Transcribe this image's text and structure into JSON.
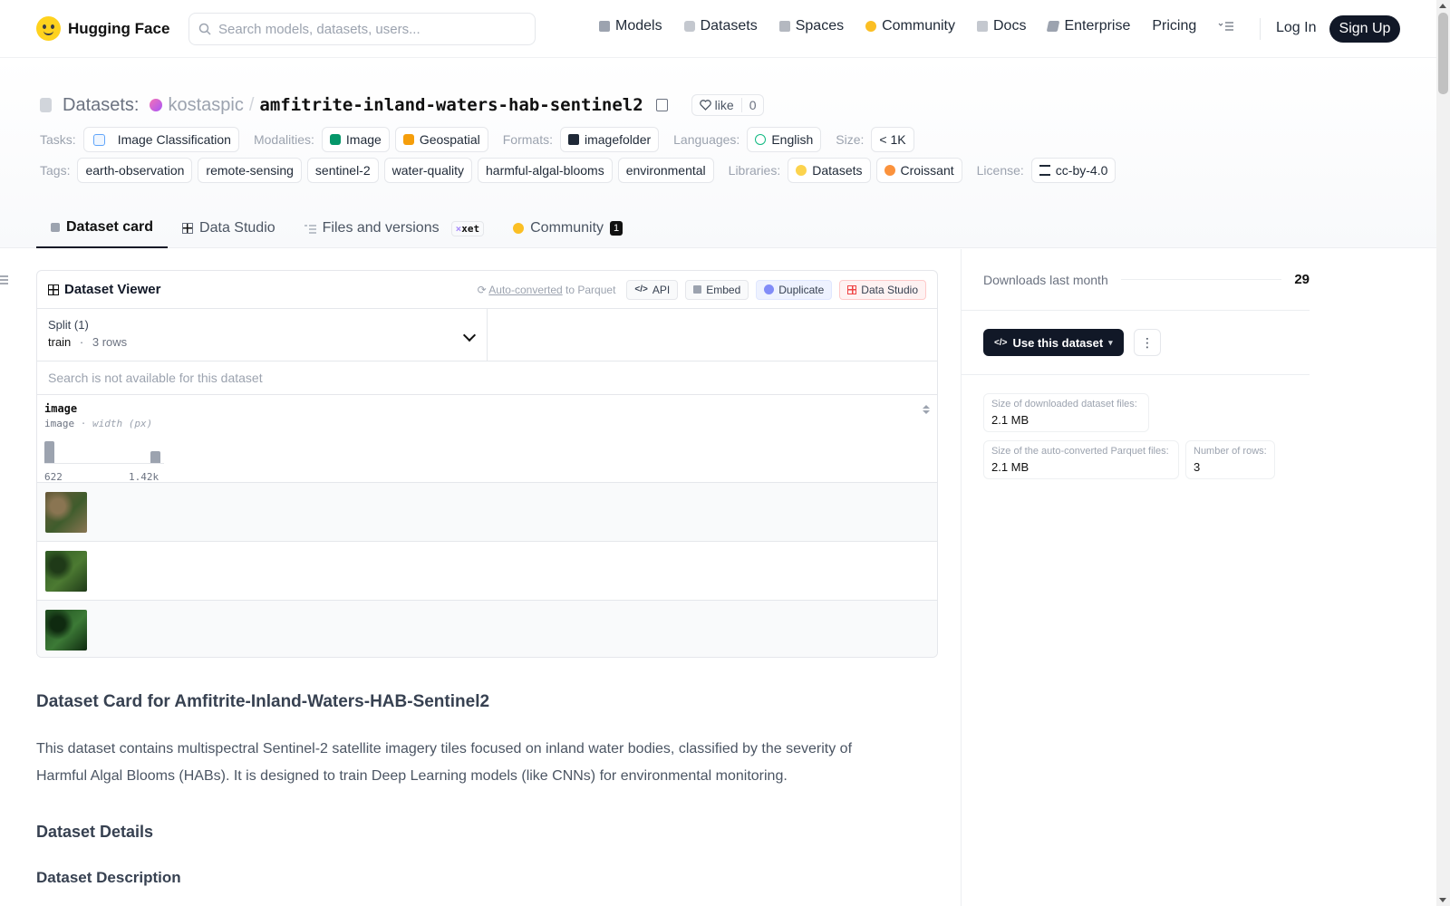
{
  "header": {
    "brand": "Hugging Face",
    "search_placeholder": "Search models, datasets, users...",
    "nav": [
      {
        "label": "Models",
        "icon": "models-icon",
        "color": "#9ca3af"
      },
      {
        "label": "Datasets",
        "icon": "datasets-icon",
        "color": "#9ca3af"
      },
      {
        "label": "Spaces",
        "icon": "spaces-icon",
        "color": "#9ca3af"
      },
      {
        "label": "Community",
        "icon": "community-icon",
        "color": "#fbbf24"
      },
      {
        "label": "Docs",
        "icon": "docs-icon",
        "color": "#9ca3af"
      },
      {
        "label": "Enterprise",
        "icon": "enterprise-icon",
        "color": "#9ca3af"
      },
      {
        "label": "Pricing"
      }
    ],
    "login": "Log In",
    "signup": "Sign Up"
  },
  "repo": {
    "type_label": "Datasets:",
    "owner": "kostaspic",
    "separator": "/",
    "name": "amfitrite-inland-waters-hab-sentinel2",
    "like_label": "like",
    "like_count": "0"
  },
  "meta": {
    "tasks_label": "Tasks:",
    "tasks": [
      "Image Classification"
    ],
    "modalities_label": "Modalities:",
    "modalities": [
      "Image",
      "Geospatial"
    ],
    "formats_label": "Formats:",
    "formats": [
      "imagefolder"
    ],
    "languages_label": "Languages:",
    "languages": [
      "English"
    ],
    "size_label": "Size:",
    "size": "< 1K",
    "tags_label": "Tags:",
    "tags": [
      "earth-observation",
      "remote-sensing",
      "sentinel-2",
      "water-quality",
      "harmful-algal-blooms",
      "environmental"
    ],
    "libraries_label": "Libraries:",
    "libraries": [
      "Datasets",
      "Croissant"
    ],
    "license_label": "License:",
    "license": "cc-by-4.0"
  },
  "tabs": [
    {
      "label": "Dataset card",
      "active": true
    },
    {
      "label": "Data Studio"
    },
    {
      "label": "Files and versions",
      "badge": "xet"
    },
    {
      "label": "Community",
      "count": "1"
    }
  ],
  "viewer": {
    "title": "Dataset Viewer",
    "auto_converted": "Auto-converted",
    "to_parquet": "to Parquet",
    "actions": [
      "API",
      "Embed",
      "Duplicate",
      "Data Studio"
    ],
    "split_label": "Split (1)",
    "split_value": "train",
    "split_sep": "·",
    "split_rows": "3 rows",
    "search_disabled": "Search is not available for this dataset",
    "column": {
      "name": "image",
      "type": "image",
      "type_sep": "·",
      "type_detail": "width (px)",
      "hist_min": "622",
      "hist_max": "1.42k",
      "hist_bins": [
        0.85,
        0.45
      ]
    },
    "rows": [
      {
        "thumb_colors": [
          "#6b5a3a",
          "#3f5c2c",
          "#8a7552"
        ]
      },
      {
        "thumb_colors": [
          "#2f5a23",
          "#4c7a32",
          "#1f3a18"
        ]
      },
      {
        "thumb_colors": [
          "#1e4a1e",
          "#3c7a36",
          "#0f2a10"
        ]
      }
    ]
  },
  "card": {
    "title": "Dataset Card for Amfitrite-Inland-Waters-HAB-Sentinel2",
    "intro": "This dataset contains multispectral Sentinel-2 satellite imagery tiles focused on inland water bodies, classified by the severity of Harmful Algal Blooms (HABs). It is designed to train Deep Learning models (like CNNs) for environmental monitoring.",
    "details_heading": "Dataset Details",
    "description_heading": "Dataset Description"
  },
  "sidebar": {
    "downloads_label": "Downloads last month",
    "downloads_value": "29",
    "use_button": "Use this dataset",
    "stats": [
      {
        "label": "Size of downloaded dataset files:",
        "value": "2.1 MB"
      },
      {
        "label": "Size of the auto-converted Parquet files:",
        "value": "2.1 MB"
      },
      {
        "label": "Number of rows:",
        "value": "3"
      }
    ]
  }
}
